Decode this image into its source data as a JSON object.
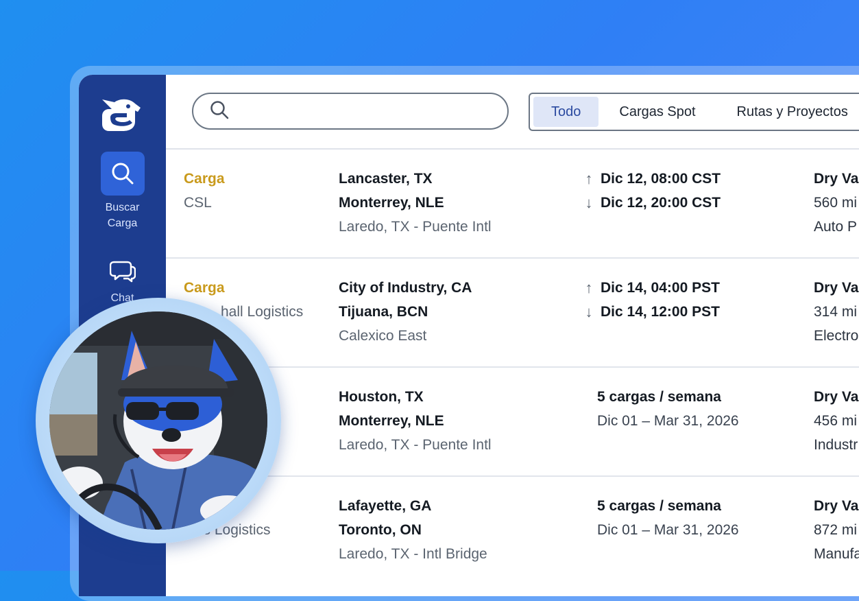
{
  "sidebar": {
    "nav": [
      {
        "label": "Buscar Carga",
        "icon": "search-icon",
        "active": true
      },
      {
        "label": "Chat",
        "icon": "chat-icon",
        "active": false
      }
    ]
  },
  "search": {
    "placeholder": ""
  },
  "tabs": [
    {
      "label": "Todo",
      "active": true
    },
    {
      "label": "Cargas Spot",
      "active": false
    },
    {
      "label": "Rutas y Proyectos",
      "active": false
    }
  ],
  "rows": [
    {
      "type": "Carga",
      "company": "CSL",
      "origin": "Lancaster, TX",
      "destination": "Monterrey, NLE",
      "crossing": "Laredo, TX - Puente Intl",
      "pickup": "Dic 12, 08:00 CST",
      "delivery": "Dic 12, 20:00 CST",
      "equipment": "Dry Va",
      "distance": "560 mi",
      "commodity": "Auto P"
    },
    {
      "type": "Carga",
      "company": "hall Logistics",
      "origin": "City of Industry, CA",
      "destination": "Tijuana, BCN",
      "crossing": "Calexico East",
      "pickup": "Dic 14, 04:00 PST",
      "delivery": "Dic 14, 12:00 PST",
      "equipment": "Dry Va",
      "distance": "314 mi",
      "commodity": "Electro"
    },
    {
      "type": "",
      "company": "",
      "origin": "Houston, TX",
      "destination": "Monterrey, NLE",
      "crossing": "Laredo, TX - Puente Intl",
      "frequency": "5 cargas / semana",
      "period": "Dic 01 – Mar 31, 2026",
      "equipment": "Dry Va",
      "distance": "456 mi",
      "commodity": "Industr"
    },
    {
      "type": "",
      "company": "ss Logistics",
      "origin": "Lafayette, GA",
      "destination": "Toronto, ON",
      "crossing": "Laredo, TX - Intl Bridge",
      "frequency": "5 cargas / semana",
      "period": "Dic 01 – Mar 31, 2026",
      "equipment": "Dry Va",
      "distance": "872 mi",
      "commodity": "Manufa"
    }
  ],
  "colors": {
    "sidebar": "#1d3d8f",
    "accent": "#2f63d8",
    "type_label": "#c99a1c",
    "background": "#2f7ff5"
  }
}
